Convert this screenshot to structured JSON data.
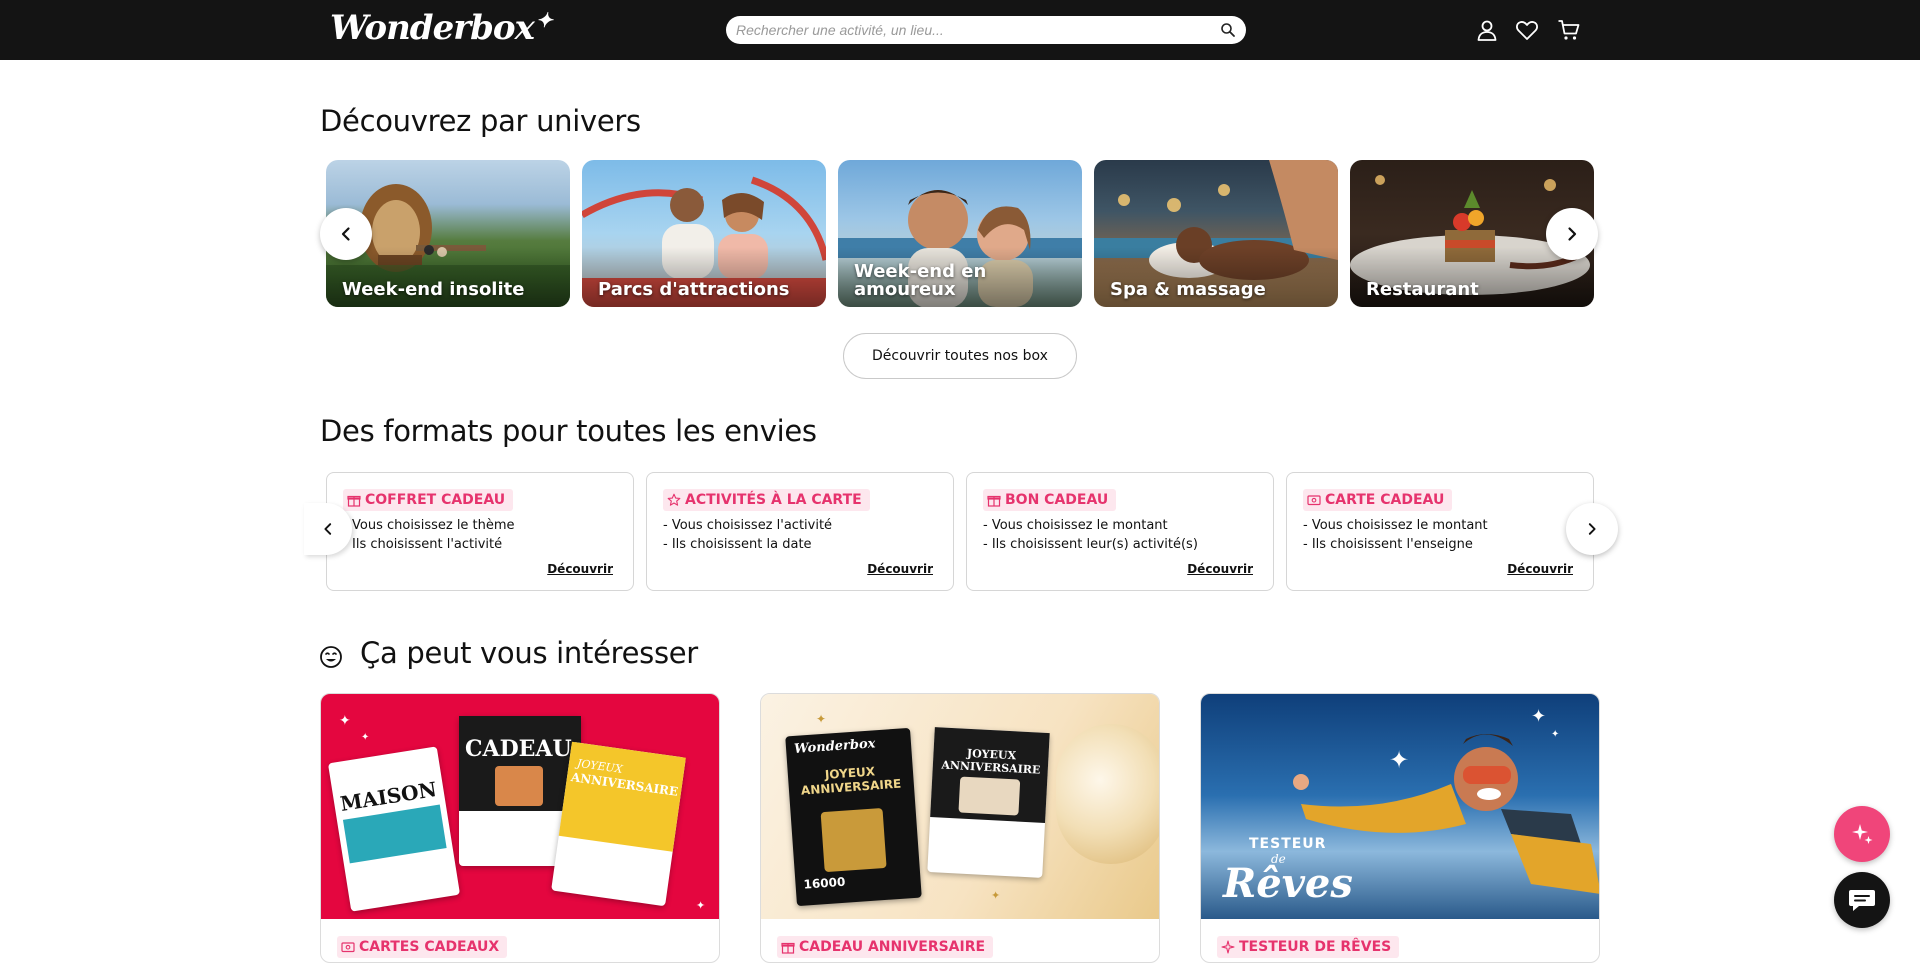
{
  "header": {
    "logo": "Wonderbox",
    "logo_spark": "✦",
    "search_placeholder": "Rechercher une activité, un lieu..."
  },
  "universes": {
    "title": "Découvrez par univers",
    "cards": [
      {
        "label": "Week-end insolite"
      },
      {
        "label": "Parcs d'attractions"
      },
      {
        "label": "Week-end en amoureux"
      },
      {
        "label": "Spa & massage"
      },
      {
        "label": "Restaurant"
      }
    ],
    "cta": "Découvrir toutes nos box"
  },
  "formats": {
    "title": "Des formats pour toutes les envies",
    "cards": [
      {
        "tag": "COFFRET CADEAU",
        "lines": [
          "Vous choisissez le thème",
          "Ils choisissent l'activité"
        ],
        "link": "Découvrir"
      },
      {
        "tag": "ACTIVITÉS À LA CARTE",
        "lines": [
          "- Vous choisissez l'activité",
          "- Ils choisissent la date"
        ],
        "link": "Découvrir"
      },
      {
        "tag": "BON CADEAU",
        "lines": [
          "- Vous choisissez le montant",
          "- Ils choisissent leur(s) activité(s)"
        ],
        "link": "Découvrir"
      },
      {
        "tag": "CARTE CADEAU",
        "lines": [
          "- Vous choisissez le montant",
          "- Ils choisissent l'enseigne"
        ],
        "link": "Découvrir"
      }
    ]
  },
  "interest": {
    "title": "Ça peut vous intéresser",
    "cards": [
      {
        "tag": "CARTES CADEAUX",
        "card_texts": [
          "MAISON",
          "CADEAU",
          "JOYEUX",
          "ANNIVERSAIRE"
        ]
      },
      {
        "tag": "CADEAU ANNIVERSAIRE",
        "card_texts": [
          "Wonderbox",
          "JOYEUX ANNIVERSAIRE",
          "16000",
          "JOYEUX ANNIVERSAIRE"
        ]
      },
      {
        "tag": "TESTEUR DE RÊVES",
        "card_texts": [
          "TESTEUR",
          "de",
          "Rêves"
        ]
      }
    ]
  },
  "colors": {
    "header_bg": "#141414",
    "accent_pink": "#e6336d",
    "tag_bg": "#fde7ee",
    "fab_pink": "#f0457a",
    "chat_dark": "#141414"
  },
  "icons": [
    "search-icon",
    "account-icon",
    "heart-icon",
    "cart-icon",
    "chevron-left-icon",
    "chevron-right-icon",
    "gift-icon",
    "star-icon",
    "card-icon",
    "smile-icon",
    "sparkle-icon",
    "chat-icon"
  ]
}
